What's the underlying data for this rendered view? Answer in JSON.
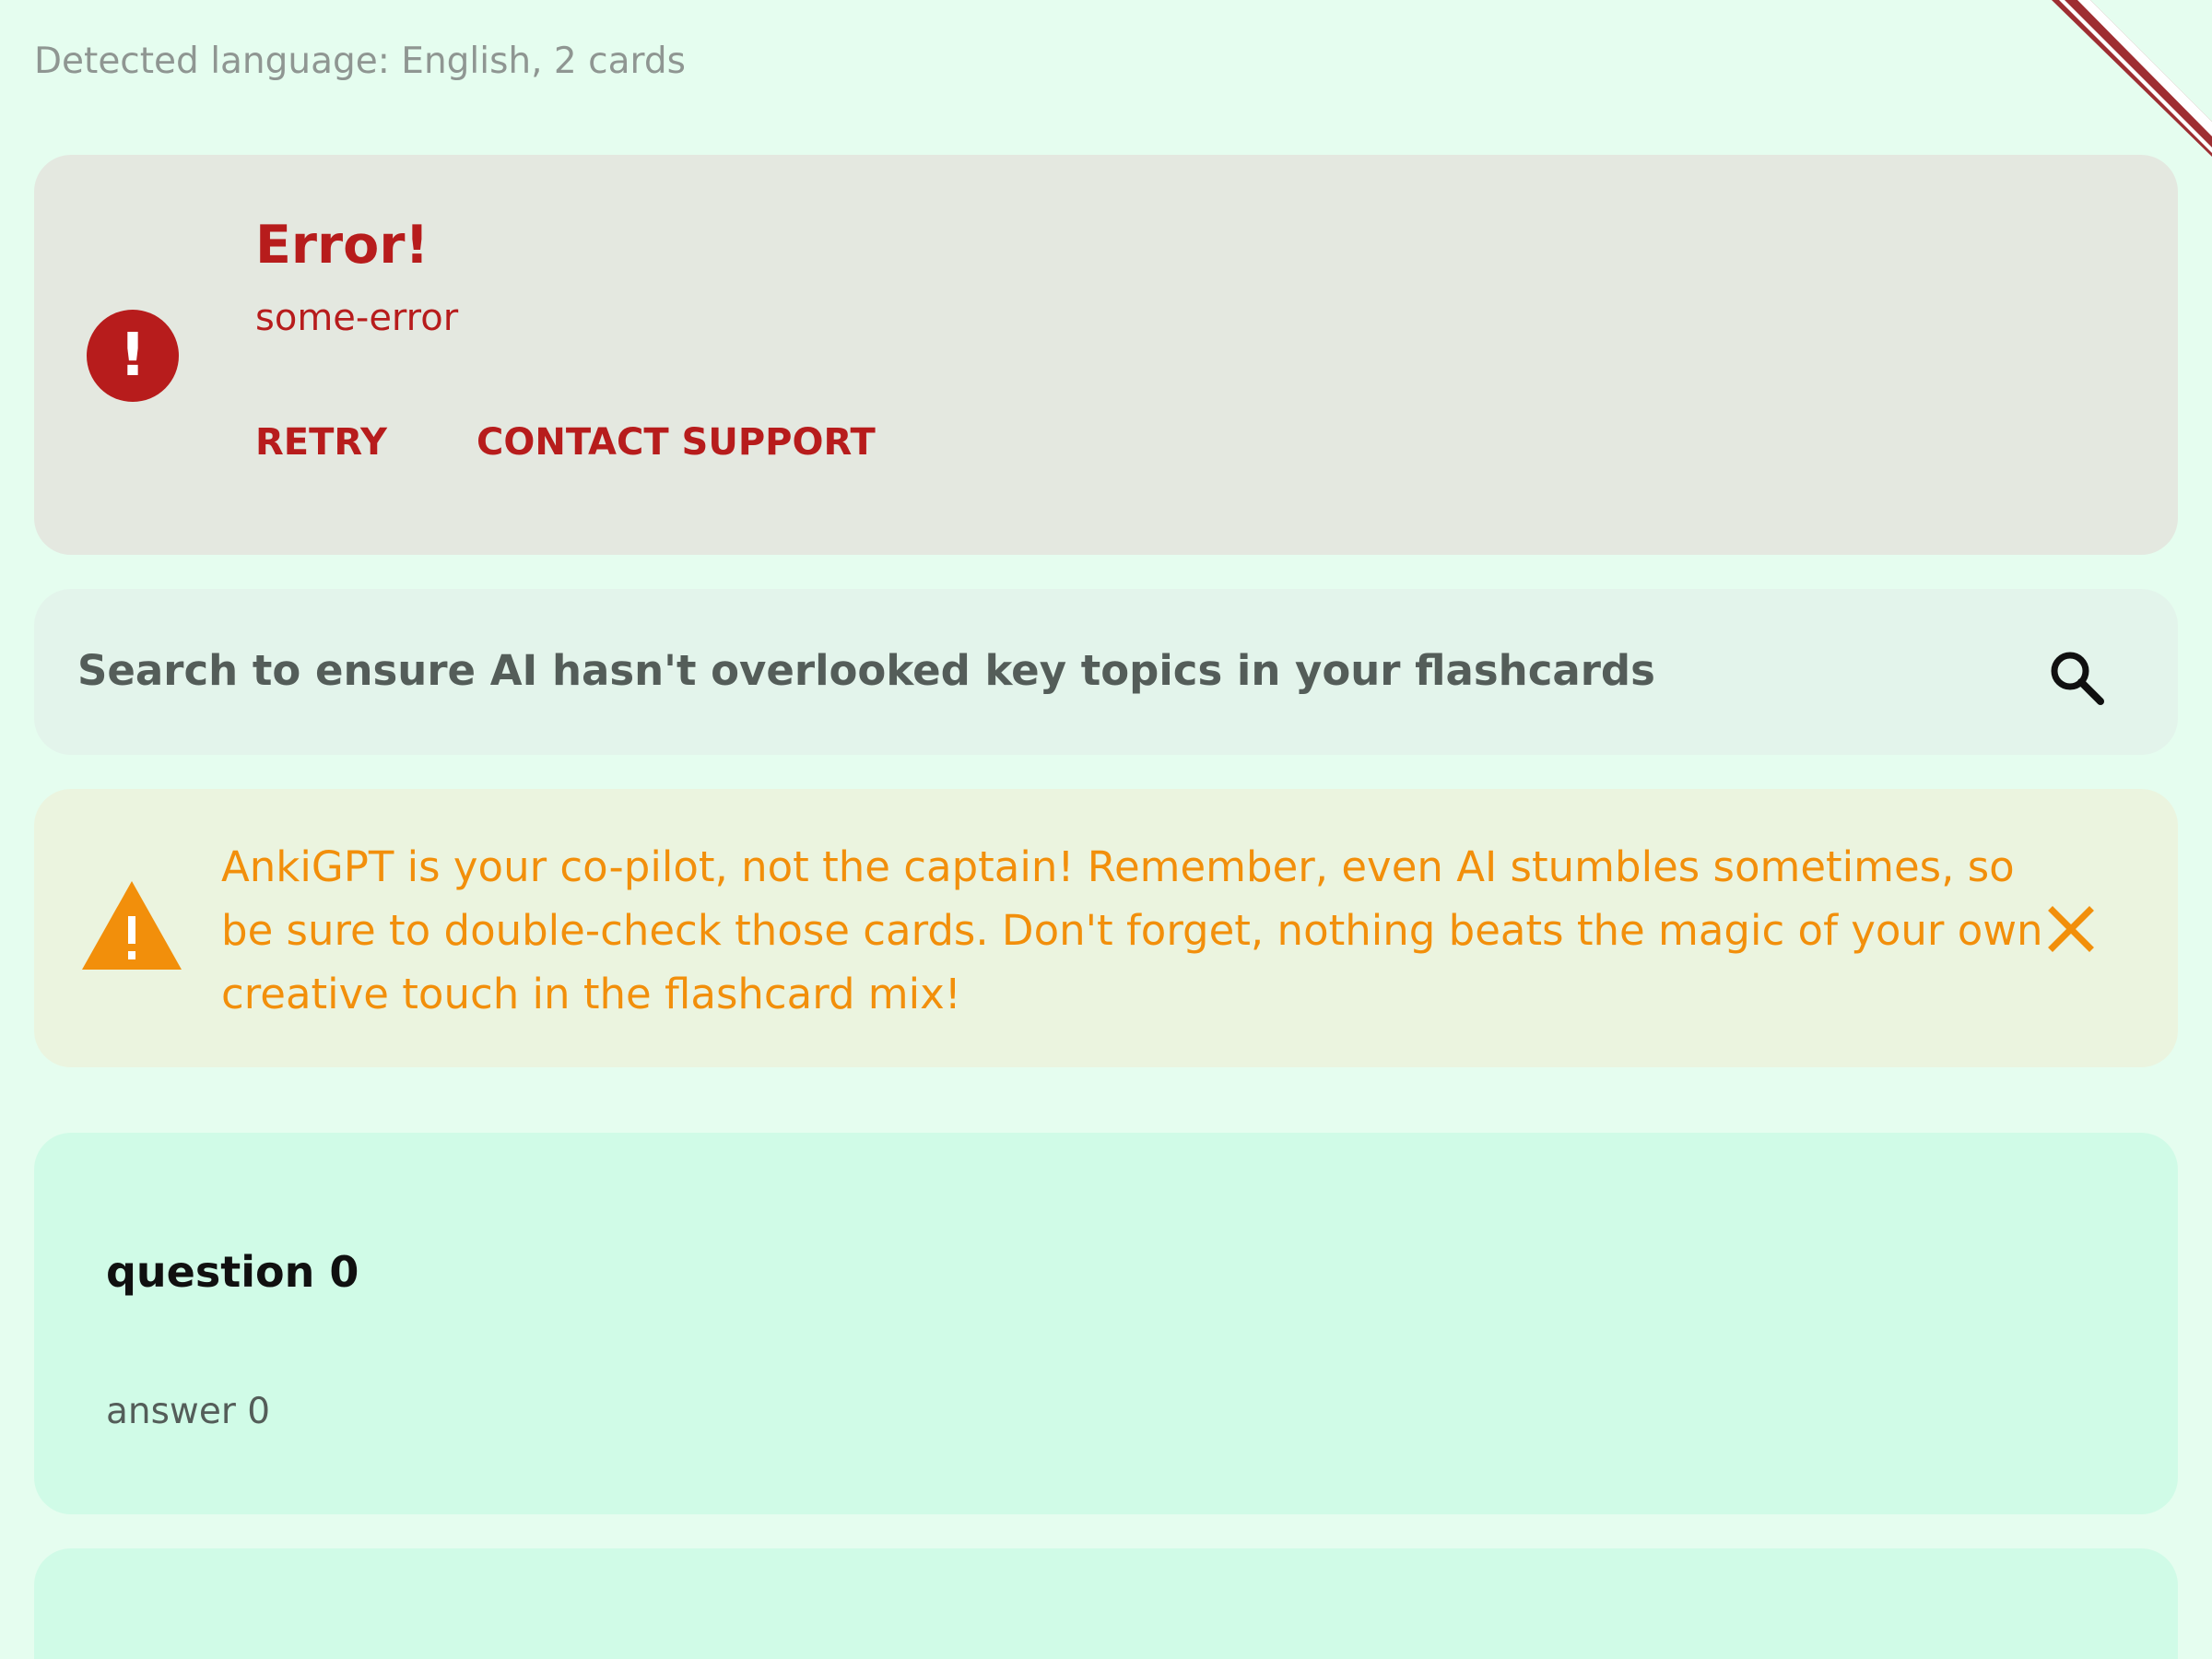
{
  "header": {
    "detected_language": "Detected language: English, 2 cards"
  },
  "error": {
    "title": "Error!",
    "message": "some-error",
    "actions": {
      "retry": "RETRY",
      "contact_support": "CONTACT SUPPORT"
    },
    "icon": "error-circle-exclamation-icon",
    "color": "#b71c1c"
  },
  "search": {
    "text": "Search to ensure AI hasn't overlooked key topics in your flashcards",
    "icon": "search-icon"
  },
  "warning": {
    "text": "AnkiGPT is your co-pilot, not the captain! Remember, even AI stumbles sometimes, so be sure to double-check those cards. Don't forget, nothing beats the magic of your own creative touch in the flashcard mix!",
    "icon": "warning-triangle-icon",
    "close_icon": "close-icon",
    "color": "#f28f0b"
  },
  "cards": [
    {
      "question": "question 0",
      "answer": "answer 0"
    },
    {
      "question": "",
      "answer": ""
    }
  ],
  "colors": {
    "background": "#e5fdef",
    "card": "#d0fbe7",
    "ribbon_red": "#9e2e32",
    "ribbon_white": "#ffffff"
  },
  "ribbon": {
    "icon": "corner-ribbon-icon"
  }
}
